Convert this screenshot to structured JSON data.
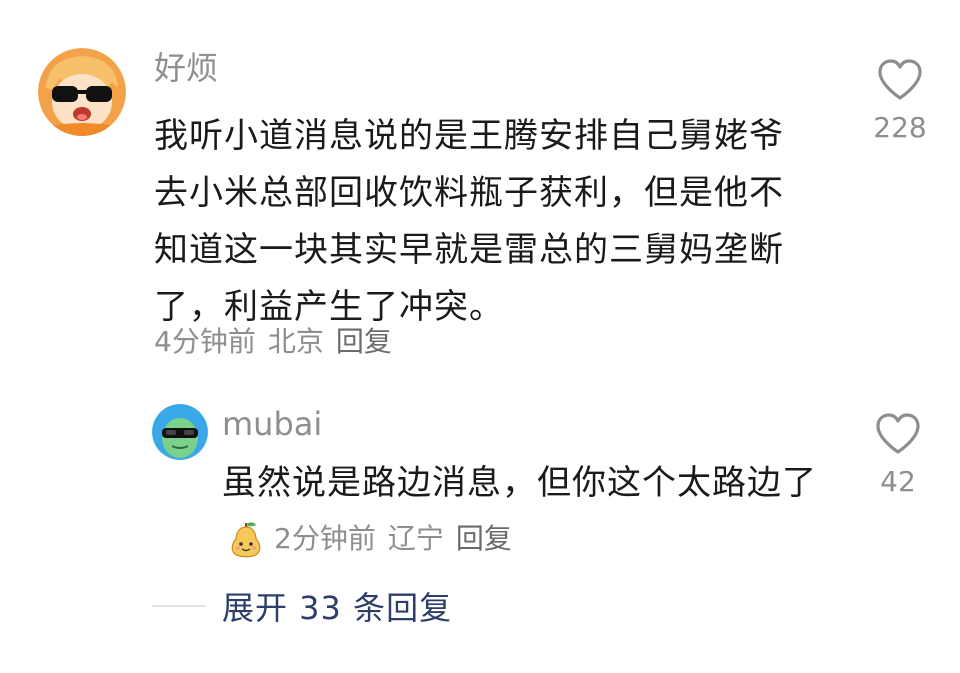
{
  "comment": {
    "username": "好烦",
    "content": "我听小道消息说的是王腾安排自己舅姥爷去小米总部回收饮料瓶子获利，但是他不知道这一块其实早就是雷总的三舅妈垄断了，利益产生了冲突。",
    "time": "4分钟前",
    "location": "北京",
    "reply_label": "回复",
    "like_count": "228",
    "avatar_icon": "sunglasses-character-avatar",
    "like_icon": "heart-outline-icon"
  },
  "reply": {
    "username": "mubai",
    "content": "虽然说是路边消息，但你这个太路边了",
    "emoji_icon": "smiling-pear-emoji",
    "time": "2分钟前",
    "location": "辽宁",
    "reply_label": "回复",
    "like_count": "42",
    "avatar_icon": "green-alien-sunglasses-avatar",
    "like_icon": "heart-outline-icon"
  },
  "expand": {
    "label": "展开 33 条回复"
  },
  "colors": {
    "username": "#8e8e8e",
    "text": "#1a1a1a",
    "link": "#2d3f68"
  }
}
